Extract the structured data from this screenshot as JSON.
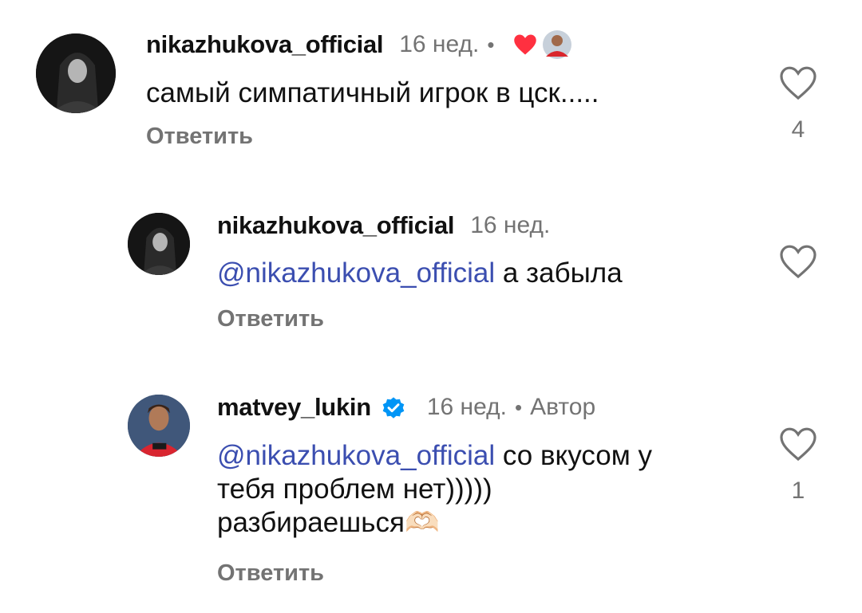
{
  "comments": [
    {
      "username": "nikazhukova_official",
      "time": "16 нед.",
      "separator": "•",
      "text": "самый симпатичный игрок в цск.....",
      "reply_label": "Ответить",
      "like_count": "4",
      "author_liked": true
    },
    {
      "username": "nikazhukova_official",
      "time": "16 нед.",
      "mention": "@nikazhukova_official",
      "text": " а забыла",
      "reply_label": "Ответить",
      "like_count": ""
    },
    {
      "username": "matvey_lukin",
      "verified": true,
      "time": "16 нед.",
      "separator": "•",
      "author_label": "Автор",
      "mention": "@nikazhukova_official",
      "text_line1": " со вкусом у",
      "text_line2": "тебя проблем нет)))))",
      "text_line3": "разбираешься🫶🏻",
      "reply_label": "Ответить",
      "like_count": "1"
    }
  ],
  "colors": {
    "mention": "#3b4eb0",
    "secondary": "#737373",
    "heart_red": "#ff3040",
    "verified_blue": "#0095f6"
  },
  "icons": [
    "heart-outline-icon",
    "heart-filled-icon",
    "verified-badge-icon"
  ]
}
